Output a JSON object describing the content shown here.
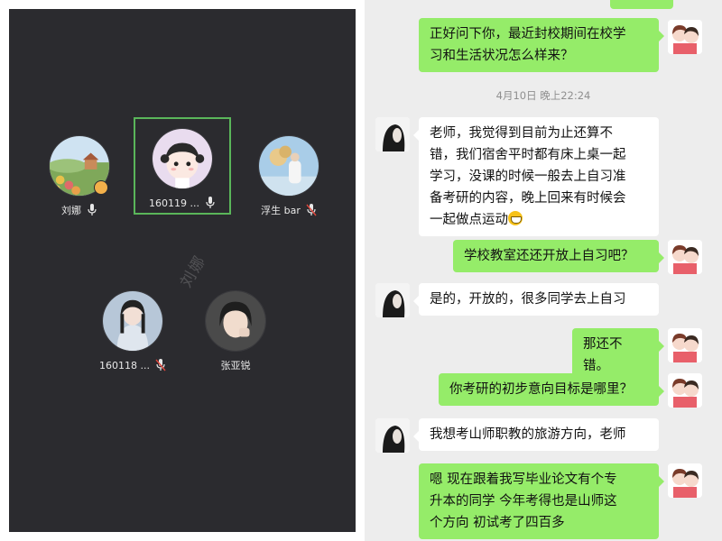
{
  "call_screen": {
    "watermark": "刘娜",
    "participants": [
      {
        "name": "刘娜",
        "mic": "mic-icon",
        "active": false
      },
      {
        "name": "160119 ...",
        "mic": "mic-icon",
        "active": true
      },
      {
        "name": "浮生 bar",
        "mic": "mic-muted-icon",
        "active": false
      },
      {
        "name": "160118 ...",
        "mic": "mic-muted-icon",
        "active": false
      },
      {
        "name": "张亚锐",
        "mic": "",
        "active": false
      }
    ],
    "colors": {
      "background": "#2b2b2f",
      "active_border": "#5ab65a"
    }
  },
  "chat": {
    "timestamp": "4月10日 晚上22:24",
    "messages": [
      {
        "side": "out",
        "lines": [
          "正好问下你，最近封校期间在校学",
          "习和生活状况怎么样来？"
        ]
      },
      {
        "side": "in",
        "lines": [
          "老师，我觉得到目前为止还算不",
          "错，我们宿舍平时都有床上桌一起",
          "学习，没课的时候一般去上自习准",
          "备考研的内容，晚上回来有时候会",
          "一起做点运动"
        ]
      },
      {
        "side": "out",
        "lines": [
          "学校教室还还开放上自习吧？"
        ]
      },
      {
        "side": "in",
        "lines": [
          "是的，开放的，很多同学去上自习"
        ]
      },
      {
        "side": "out",
        "lines": [
          "那还不错。"
        ]
      },
      {
        "side": "out",
        "lines": [
          "你考研的初步意向目标是哪里？"
        ]
      },
      {
        "side": "in",
        "lines": [
          "我想考山师职教的旅游方向，老师"
        ]
      },
      {
        "side": "out",
        "lines": [
          "嗯 现在跟着我写毕业论文有个专",
          "升本的同学 今年考得也是山师这",
          "个方向 初试考了四百多"
        ]
      }
    ],
    "colors": {
      "background": "#ededed",
      "outgoing": "#95ec69",
      "incoming": "#ffffff",
      "timestamp": "#8f8f8f"
    }
  }
}
